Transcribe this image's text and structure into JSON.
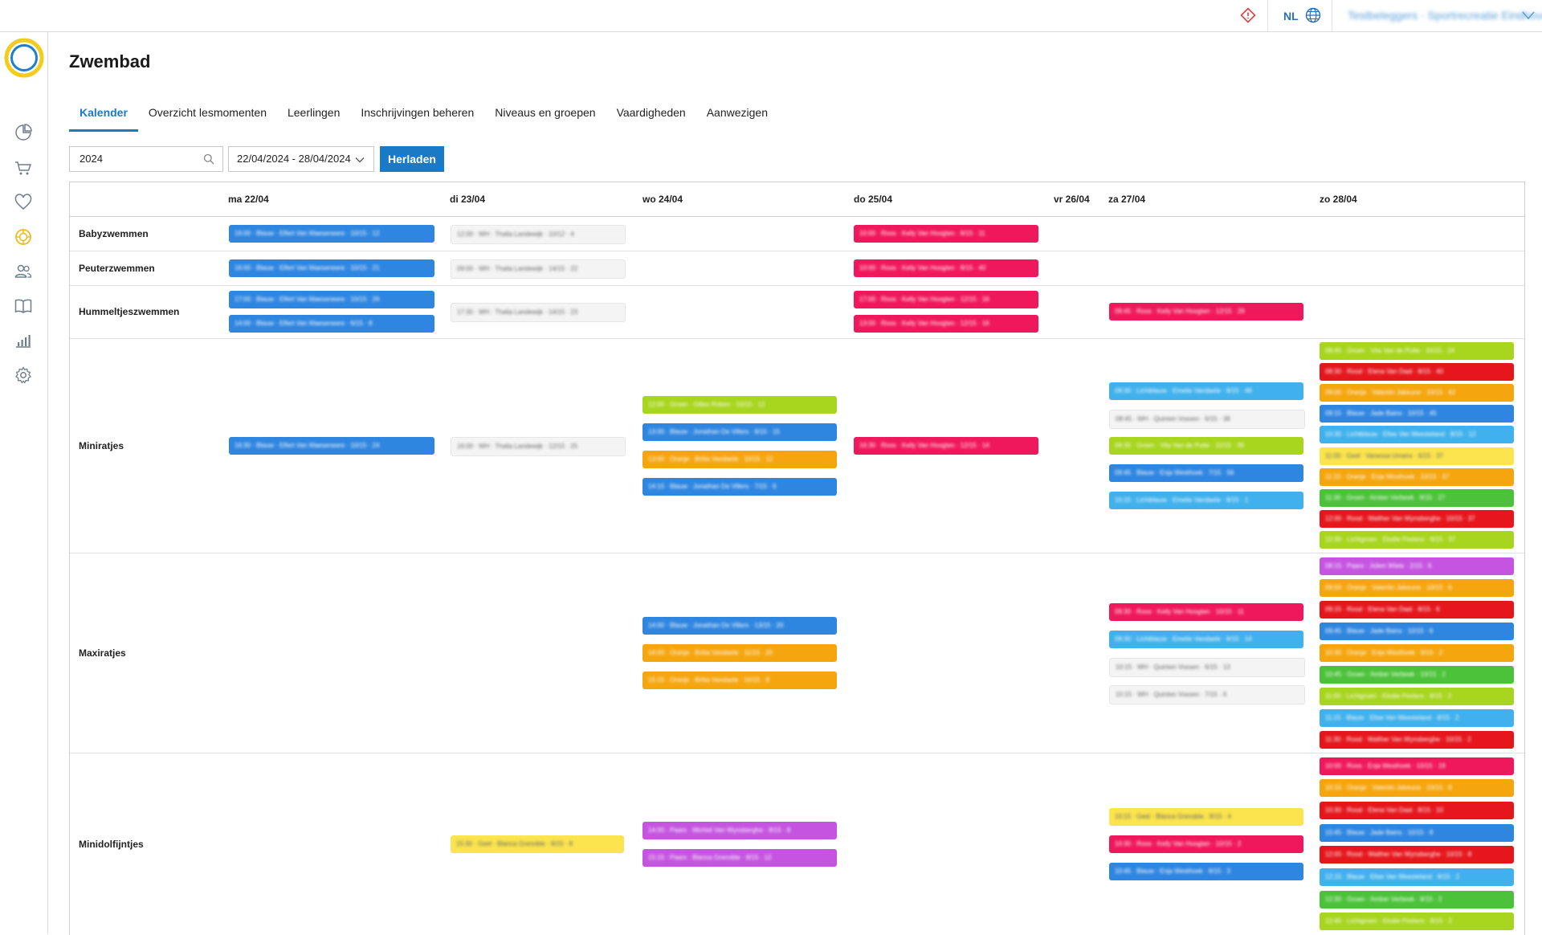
{
  "topbar": {
    "language": "NL",
    "user_label": "Testbeleggers · Sportrecreatie Eindhoven"
  },
  "page": {
    "title": "Zwembad"
  },
  "tabs": [
    {
      "label": "Kalender",
      "active": true
    },
    {
      "label": "Overzicht lesmomenten"
    },
    {
      "label": "Leerlingen"
    },
    {
      "label": "Inschrijvingen beheren"
    },
    {
      "label": "Niveaus en groepen"
    },
    {
      "label": "Vaardigheden"
    },
    {
      "label": "Aanwezigen"
    }
  ],
  "filters": {
    "year_value": "2024",
    "date_range": "22/04/2024 - 28/04/2024",
    "reload_label": "Herladen"
  },
  "colors": {
    "accent": "#1a7ac6",
    "blauw": "#2f86e0",
    "wit": "#f4f4f4",
    "roze": "#f0185c",
    "groen": "#a8d51e",
    "oranje": "#f5a60f",
    "lichtblauw": "#40b1ec",
    "rood": "#e5171d",
    "geel": "#fbe44e",
    "donkergroen": "#4cc23a",
    "paars": "#c555e0"
  },
  "calendar": {
    "days": [
      "ma 22/04",
      "di 23/04",
      "wo 24/04",
      "do 25/04",
      "vr 26/04",
      "za 27/04",
      "zo 28/04"
    ],
    "rows": [
      {
        "name": "Babyzwemmen",
        "events": [
          {
            "day": 0,
            "color": "blauw",
            "text": "16:00 · Blauw · Elfert Van Maeseneere · 10/15 · 12"
          },
          {
            "day": 1,
            "color": "wit",
            "text": "12:00 · WH · Thalia Landewijk · 10/12 · 4"
          },
          {
            "day": 3,
            "color": "roze",
            "text": "10:00 · Roos · Kelly Van Hoogten · 8/15 · 11"
          }
        ]
      },
      {
        "name": "Peuterzwemmen",
        "events": [
          {
            "day": 0,
            "color": "blauw",
            "text": "16:00 · Blauw · Elfert Van Maeseneere · 10/15 · 21"
          },
          {
            "day": 1,
            "color": "wit",
            "text": "09:00 · WH · Thalia Landewijk · 14/15 · 22"
          },
          {
            "day": 3,
            "color": "roze",
            "text": "10:00 · Roos · Kelly Van Hoogten · 8/15 · 40"
          }
        ]
      },
      {
        "name": "Hummeltjeszwemmen",
        "events": [
          {
            "day": 0,
            "color": "blauw",
            "text": "17:00 · Blauw · Elfert Van Maeseneere · 10/15 · 26"
          },
          {
            "day": 0,
            "color": "blauw",
            "text": "14:00 · Blauw · Elfert Van Maeseneere · 6/15 · 8"
          },
          {
            "day": 1,
            "color": "wit",
            "text": "17:30 · WH · Thalia Landewijk · 14/15 · 23"
          },
          {
            "day": 3,
            "color": "roze",
            "text": "17:00 · Roos · Kelly Van Hoogten · 12/15 · 16"
          },
          {
            "day": 3,
            "color": "roze",
            "text": "13:00 · Roos · Kelly Van Hoogten · 12/15 · 16"
          },
          {
            "day": 5,
            "color": "roze",
            "text": "09:45 · Roos · Kelly Van Hoogten · 12/15 · 29"
          }
        ]
      },
      {
        "name": "Miniratjes",
        "events": [
          {
            "day": 0,
            "color": "blauw",
            "text": "16:30 · Blauw · Elfert Van Maeseneere · 10/15 · 24"
          },
          {
            "day": 1,
            "color": "wit",
            "text": "16:00 · WH · Thalia Landewijk · 12/15 · 25"
          },
          {
            "day": 2,
            "color": "groen",
            "text": "12:00 · Groen · Gilles Roben · 10/15 · 12"
          },
          {
            "day": 2,
            "color": "blauw",
            "text": "13:00 · Blauw · Jonathan De Villers · 8/15 · 15"
          },
          {
            "day": 2,
            "color": "oranje",
            "text": "13:00 · Oranje · Britta Vandaele · 10/15 · 12"
          },
          {
            "day": 2,
            "color": "blauw",
            "text": "14:15 · Blauw · Jonathan De Villers · 7/15 · 6"
          },
          {
            "day": 3,
            "color": "roze",
            "text": "16:30 · Roos · Kelly Van Hoogten · 12/15 · 14"
          },
          {
            "day": 5,
            "color": "lichtblauw",
            "text": "09:30 · Lichtblauw · Emelie Vandaele · 8/15 · 48"
          },
          {
            "day": 5,
            "color": "wit",
            "text": "08:45 · WH · Quinten Vossen · 6/15 · 38"
          },
          {
            "day": 5,
            "color": "groen",
            "text": "09:30 · Groen · Vita Van de Putte · 10/15 · 36"
          },
          {
            "day": 5,
            "color": "blauw",
            "text": "09:45 · Blauw · Enja Westhoek · 7/15 · 56"
          },
          {
            "day": 5,
            "color": "lichtblauw",
            "text": "10:15 · Lichtblauw · Emelie Vandaele · 8/15 · 1"
          },
          {
            "day": 6,
            "color": "groen",
            "text": "08:45 · Groen · Vita Van de Putte · 10/15 · 24"
          },
          {
            "day": 6,
            "color": "rood",
            "text": "08:30 · Rood · Elena Van Daal · 8/15 · 40"
          },
          {
            "day": 6,
            "color": "oranje",
            "text": "09:00 · Oranje · Valentin Jakeune · 10/15 · 42"
          },
          {
            "day": 6,
            "color": "blauw",
            "text": "09:15 · Blauw · Jade Bains · 10/15 · 45"
          },
          {
            "day": 6,
            "color": "lichtblauw",
            "text": "10:30 · Lichtblauw · Elise Van Meesteland · 8/15 · 12"
          },
          {
            "day": 6,
            "color": "geel",
            "text": "11:00 · Geel · Vanessa Umans · 6/15 · 37"
          },
          {
            "day": 6,
            "color": "oranje",
            "text": "11:15 · Oranje · Enja Westhoek · 10/15 · 37"
          },
          {
            "day": 6,
            "color": "donkergroen",
            "text": "11:30 · Groen · Amber Verbeek · 8/15 · 27"
          },
          {
            "day": 6,
            "color": "rood",
            "text": "12:00 · Rood · Walther Van Wynsberghe · 10/15 · 37"
          },
          {
            "day": 6,
            "color": "groen",
            "text": "12:30 · Lichtgroen · Elodie Peeters · 8/15 · 37"
          }
        ]
      },
      {
        "name": "Maxiratjes",
        "events": [
          {
            "day": 2,
            "color": "blauw",
            "text": "14:00 · Blauw · Jonathan De Villers · 13/15 · 20"
          },
          {
            "day": 2,
            "color": "oranje",
            "text": "14:00 · Oranje · Britta Vandaele · 11/15 · 20"
          },
          {
            "day": 2,
            "color": "oranje",
            "text": "15:15 · Oranje · Britta Vandaele · 10/15 · 8"
          },
          {
            "day": 5,
            "color": "roze",
            "text": "09:30 · Roos · Kelly Van Hoogten · 10/15 · 11"
          },
          {
            "day": 5,
            "color": "lichtblauw",
            "text": "09:30 · Lichtblauw · Emelie Vandaele · 8/15 · 14"
          },
          {
            "day": 5,
            "color": "wit",
            "text": "10:15 · WH · Quinten Vossen · 6/15 · 13"
          },
          {
            "day": 5,
            "color": "wit",
            "text": "10:15 · WH · Quinten Vossen · 7/15 · 6"
          },
          {
            "day": 6,
            "color": "paars",
            "text": "08:15 · Paars · Jolien Wiele · 2/15 · 6"
          },
          {
            "day": 6,
            "color": "oranje",
            "text": "09:00 · Oranje · Valentin Jakeune · 10/15 · 6"
          },
          {
            "day": 6,
            "color": "rood",
            "text": "09:15 · Rood · Elena Van Daal · 8/15 · 6"
          },
          {
            "day": 6,
            "color": "blauw",
            "text": "09:45 · Blauw · Jade Bains · 10/15 · 6"
          },
          {
            "day": 6,
            "color": "oranje",
            "text": "10:30 · Oranje · Enja Westhoek · 8/15 · 2"
          },
          {
            "day": 6,
            "color": "donkergroen",
            "text": "10:45 · Groen · Amber Verbeek · 10/15 · 2"
          },
          {
            "day": 6,
            "color": "groen",
            "text": "11:00 · Lichtgroen · Elodie Peeters · 8/15 · 2"
          },
          {
            "day": 6,
            "color": "lichtblauw",
            "text": "11:15 · Blauw · Elise Van Meesteland · 8/15 · 2"
          },
          {
            "day": 6,
            "color": "rood",
            "text": "11:30 · Rood · Walther Van Wynsberghe · 10/15 · 2"
          }
        ]
      },
      {
        "name": "Minidolfijntjes",
        "events": [
          {
            "day": 1,
            "color": "geel",
            "text": "15:30 · Geel · Blanca Grenoble · 9/15 · 8"
          },
          {
            "day": 2,
            "color": "paars",
            "text": "14:00 · Paars · Michiel Van Wynsberghe · 8/15 · 8"
          },
          {
            "day": 2,
            "color": "paars",
            "text": "15:15 · Paars · Blanca Grenoble · 8/15 · 12"
          },
          {
            "day": 5,
            "color": "geel",
            "text": "10:15 · Geel · Blanca Grenoble · 8/15 · 4"
          },
          {
            "day": 5,
            "color": "roze",
            "text": "10:30 · Roos · Kelly Van Hoogten · 10/15 · 2"
          },
          {
            "day": 5,
            "color": "blauw",
            "text": "10:45 · Blauw · Enja Westhoek · 8/15 · 3"
          },
          {
            "day": 6,
            "color": "roze",
            "text": "10:00 · Roos · Enja Westhoek · 10/15 · 19"
          },
          {
            "day": 6,
            "color": "oranje",
            "text": "10:15 · Oranje · Valentin Jakeune · 10/15 · 6"
          },
          {
            "day": 6,
            "color": "rood",
            "text": "10:30 · Rood · Elena Van Daal · 8/15 · 10"
          },
          {
            "day": 6,
            "color": "blauw",
            "text": "10:45 · Blauw · Jade Bains · 10/15 · 8"
          },
          {
            "day": 6,
            "color": "rood",
            "text": "12:00 · Rood · Walther Van Wynsberghe · 10/15 · 8"
          },
          {
            "day": 6,
            "color": "lichtblauw",
            "text": "12:15 · Blauw · Elise Van Meesteland · 8/15 · 2"
          },
          {
            "day": 6,
            "color": "donkergroen",
            "text": "12:30 · Groen · Amber Verbeek · 8/15 · 2"
          },
          {
            "day": 6,
            "color": "groen",
            "text": "12:45 · Lichtgroen · Elodie Peeters · 8/15 · 2"
          }
        ]
      }
    ]
  }
}
